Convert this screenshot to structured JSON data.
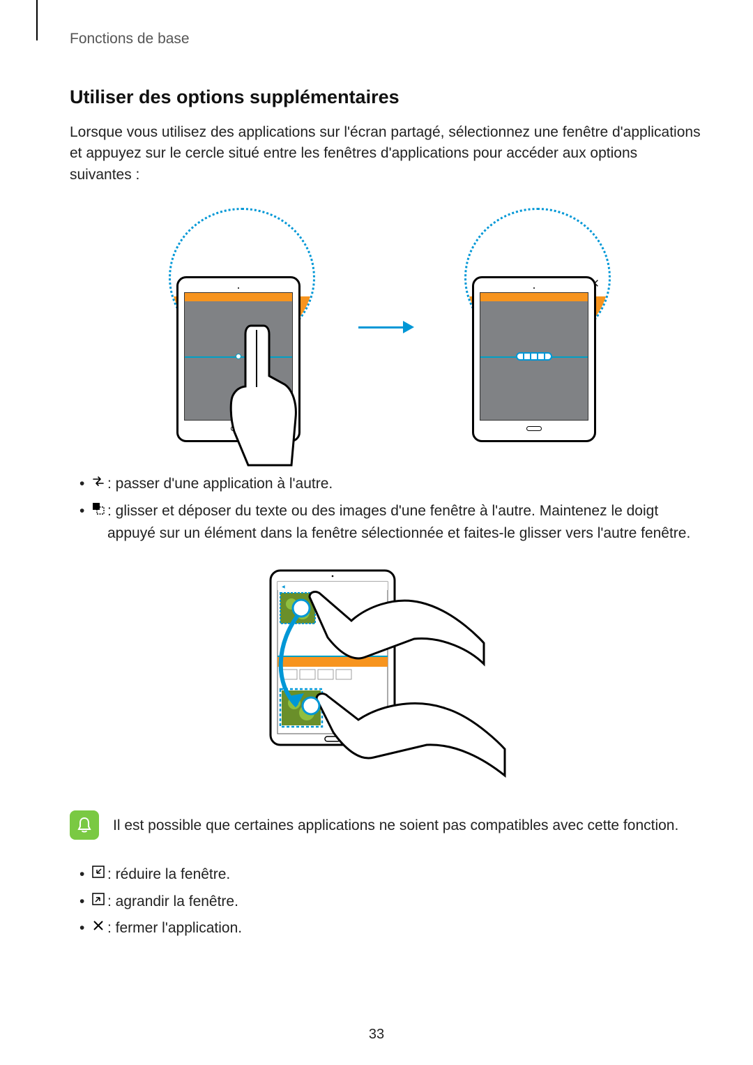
{
  "breadcrumb": "Fonctions de base",
  "section_title": "Utiliser des options supplémentaires",
  "intro": "Lorsque vous utilisez des applications sur l'écran partagé, sélectionnez une fenêtre d'applications et appuyez sur le cercle situé entre les fenêtres d'applications pour accéder aux options suivantes :",
  "bullets_a": [
    {
      "icon": "swap",
      "text": " : passer d'une application à l'autre."
    },
    {
      "icon": "dragdrop",
      "text": " : glisser et déposer du texte ou des images d'une fenêtre à l'autre. Maintenez le doigt appuyé sur un élément dans la fenêtre sélectionnée et faites-le glisser vers l'autre fenêtre."
    }
  ],
  "note_text": "Il est possible que certaines applications ne soient pas compatibles avec cette fonction.",
  "bullets_b": [
    {
      "icon": "minimize",
      "text": " : réduire la fenêtre."
    },
    {
      "icon": "maximize",
      "text": " : agrandir la fenêtre."
    },
    {
      "icon": "close",
      "text": " : fermer l'application."
    }
  ],
  "page_number": "33",
  "toolbar_icons": [
    "swap",
    "dragdrop",
    "minimize",
    "maximize",
    "close"
  ]
}
